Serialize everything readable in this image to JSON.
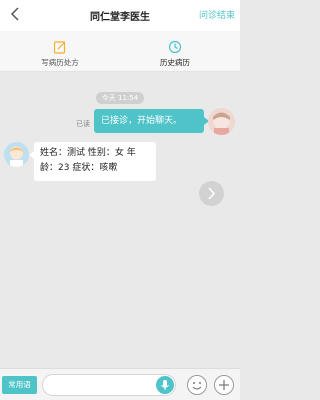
{
  "header": {
    "title": "同仁堂李医生",
    "end_label": "问诊结束",
    "back_icon": "chevron-left-icon"
  },
  "toolbar": {
    "items": [
      {
        "label": "写病历处方",
        "icon": "edit-prescription-icon"
      },
      {
        "label": "历史病历",
        "icon": "clock-icon"
      }
    ]
  },
  "chat": {
    "time_label": "今天 11:54",
    "messages": [
      {
        "side": "right",
        "status": "已读",
        "text": "已接诊，开始聊天。"
      },
      {
        "side": "left",
        "line1": "姓名：测试  性别：女  年",
        "line2": "龄：23  症状：咳嗽"
      }
    ]
  },
  "input_bar": {
    "phrases_label": "常用语",
    "input_value": "",
    "icons": [
      "mic-icon",
      "emoji-icon",
      "plus-icon"
    ]
  },
  "colors": {
    "accent": "#4ec3c8",
    "background": "#e9e9e9"
  }
}
